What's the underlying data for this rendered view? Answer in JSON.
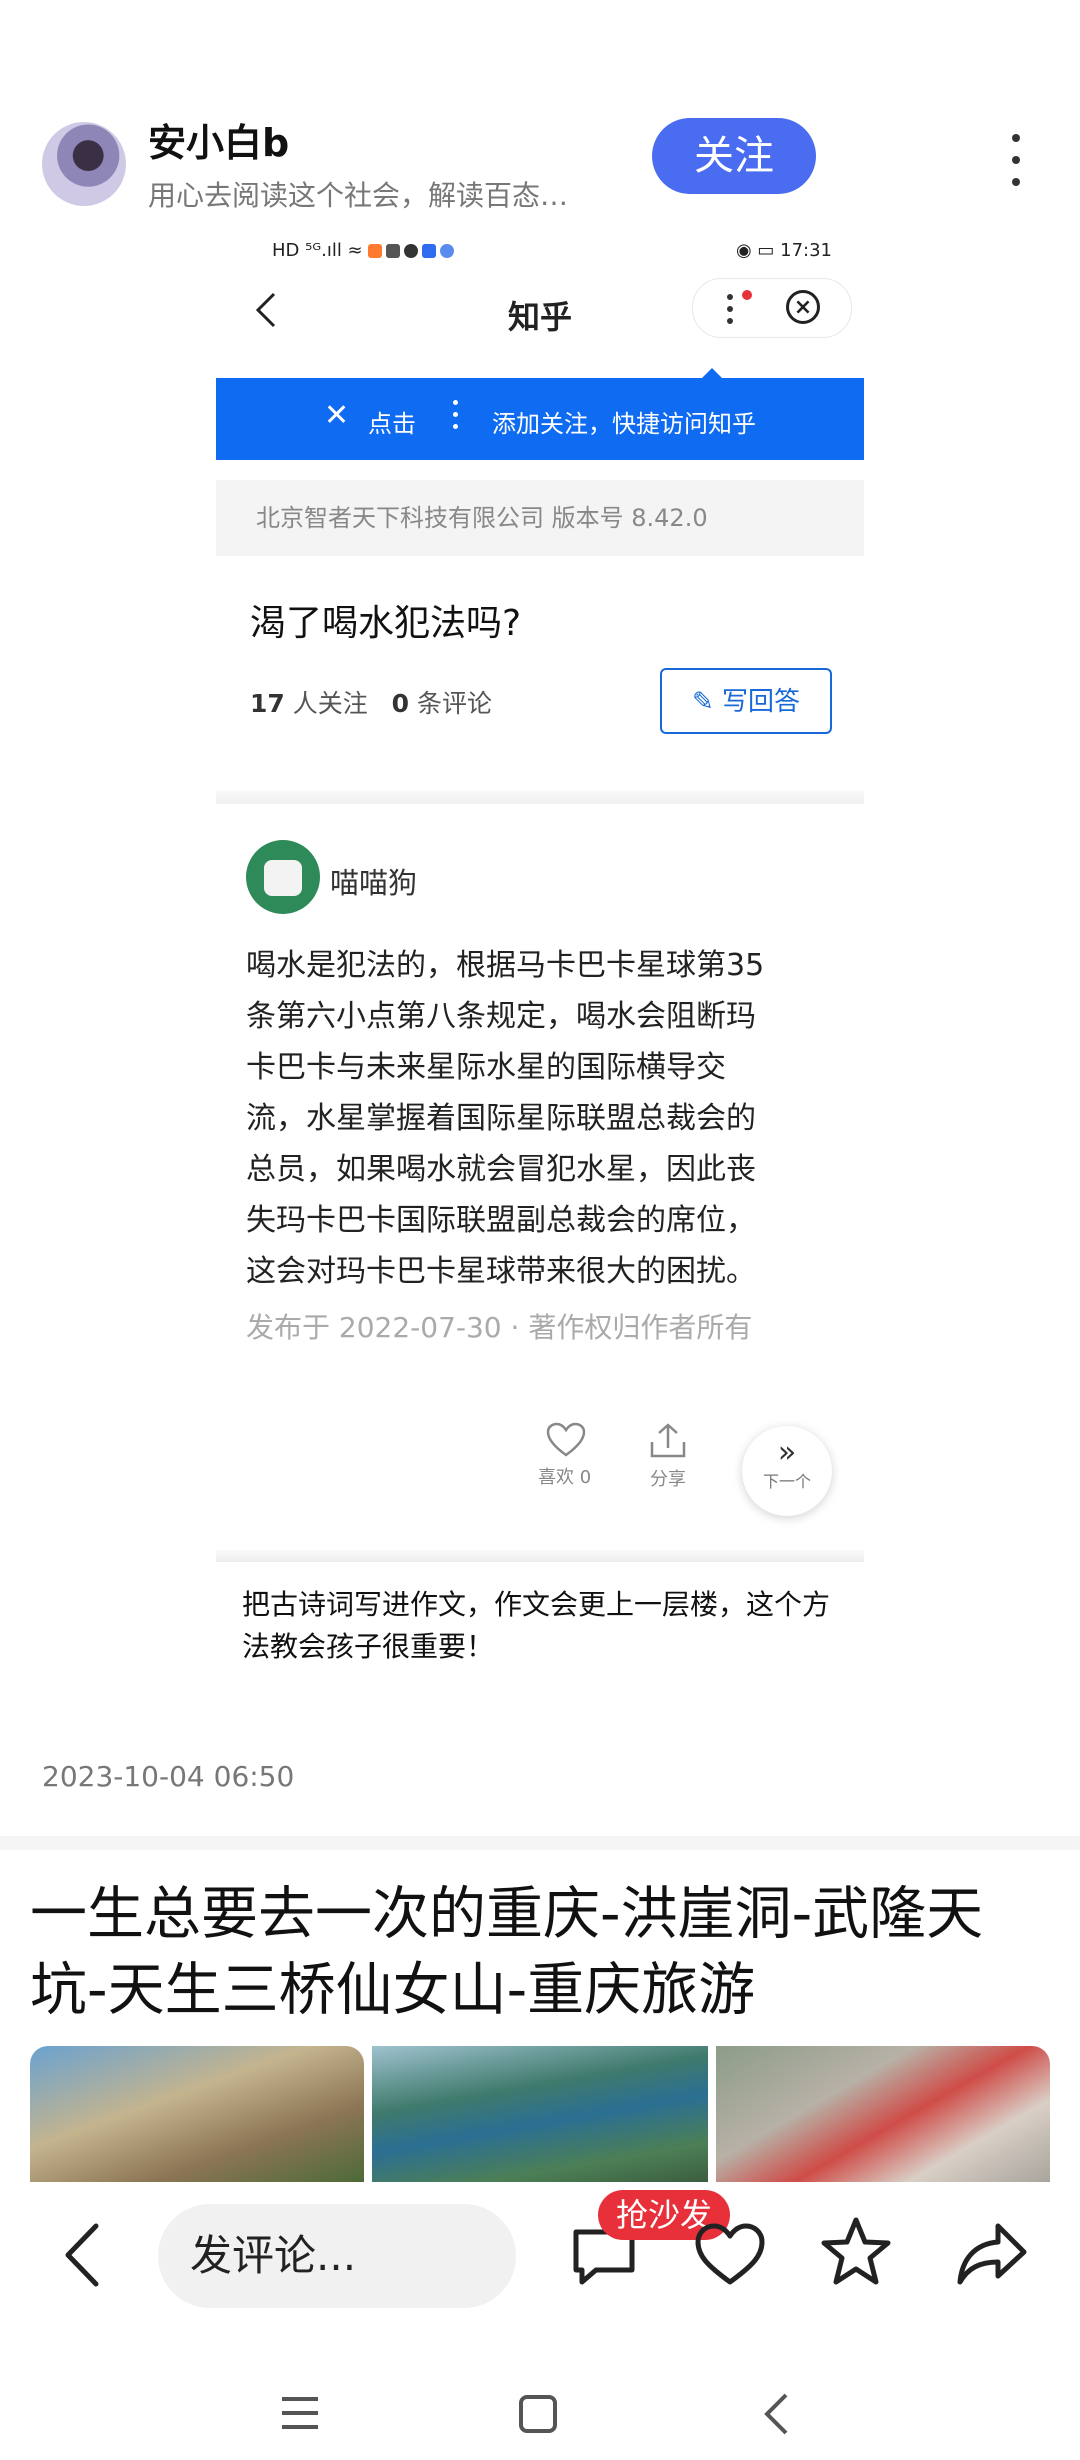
{
  "author": {
    "name": "安小白b",
    "tagline": "用心去阅读这个社会，解读百态…",
    "follow_label": "关注"
  },
  "embedded_screenshot": {
    "status_bar": {
      "left": "HD ⁵ᴳ.ıll ≈",
      "time": "17:31"
    },
    "app_title": "知乎",
    "banner": {
      "close_glyph": "✕",
      "tap": "点击",
      "text": "添加关注，快捷访问知乎"
    },
    "company_line": "北京智者天下科技有限公司 版本号 8.42.0",
    "question": {
      "title": "渴了喝水犯法吗?",
      "followers_count": "17",
      "followers_label": " 人关注",
      "comments_count": "0",
      "comments_label": " 条评论",
      "write_answer_label": "写回答"
    },
    "answer": {
      "author": "喵喵狗",
      "lines": [
        "喝水是犯法的，根据马卡巴卡星球第35",
        "条第六小点第八条规定，喝水会阻断玛",
        "卡巴卡与未来星际水星的国际横导交",
        "流，水星掌握着国际星际联盟总裁会的",
        "总员，如果喝水就会冒犯水星，因此丧",
        "失玛卡巴卡国际联盟副总裁会的席位，",
        "这会对玛卡巴卡星球带来很大的困扰。"
      ],
      "meta": "发布于 2022-07-30 · 著作权归作者所有",
      "like_label": "喜欢 0",
      "share_label": "分享",
      "next_arrows": "»",
      "next_label": "下一个"
    },
    "teaser": "把古诗词写进作文，作文会更上一层楼，这个方法教会孩子很重要！"
  },
  "post_time": "2023-10-04 06:50",
  "next_article": {
    "title": "一生总要去一次的重庆-洪崖洞-武隆天坑-天生三桥仙女山-重庆旅游"
  },
  "bottom_bar": {
    "comment_placeholder": "发评论...",
    "hot_badge": "抢沙发",
    "icons": [
      "back-chevron-icon",
      "comment-icon",
      "like-heart-icon",
      "star-icon",
      "share-arrow-icon"
    ]
  },
  "colors": {
    "follow_button": "#4a6cf0",
    "zhihu_blue": "#0f6cf2",
    "badge_red": "#e8303b"
  }
}
